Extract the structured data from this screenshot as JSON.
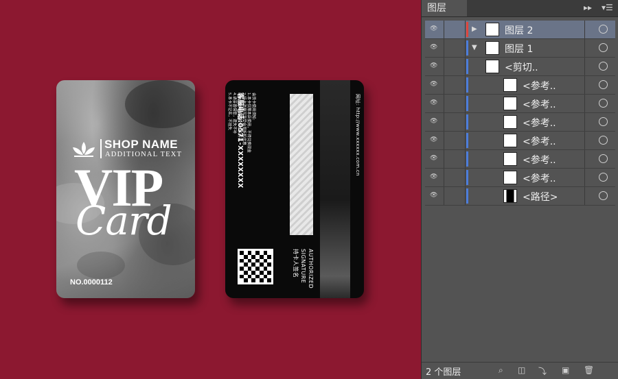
{
  "artwork": {
    "front": {
      "shop_name": "SHOP NAME",
      "additional_text": "ADDITIONAL TEXT",
      "vip": "VIP",
      "card_word": "Card",
      "card_no": "NO.0000112"
    },
    "back": {
      "website": "网址: http://www.xxxxxx.com.cn",
      "hotline": "客服电话:0571-XXXXXXXX",
      "rules": [
        "会员卡使用须知:",
        "1.本卡仅限本店使用，不得兑换现金",
        "2.持卡消费可享受会员折扣优惠",
        "3.本卡最终解释权归本店所有",
        "4.请妥善保管，遗失不补",
        "5.本卡不记名，不挂失"
      ],
      "sign_en_1": "AUTHORIZED",
      "sign_en_2": "SIGNATURE",
      "sign_cn": "持卡人签名"
    }
  },
  "panel": {
    "tab_title": "图层",
    "collapse_icon": "double-chevron-right-icon",
    "menu_icon": "panel-menu-icon",
    "layers": [
      {
        "name": "图层 2",
        "color": "#e0453c",
        "selected": true,
        "indent": 0,
        "expander": "right"
      },
      {
        "name": "图层 1",
        "color": "#4c7ddb",
        "selected": false,
        "indent": 0,
        "expander": "down"
      },
      {
        "name": "<剪切..",
        "color": "#4c7ddb",
        "selected": false,
        "indent": 1,
        "expander": "right"
      },
      {
        "name": "<参考..",
        "color": "#4c7ddb",
        "selected": false,
        "indent": 2,
        "expander": ""
      },
      {
        "name": "<参考..",
        "color": "#4c7ddb",
        "selected": false,
        "indent": 2,
        "expander": ""
      },
      {
        "name": "<参考..",
        "color": "#4c7ddb",
        "selected": false,
        "indent": 2,
        "expander": ""
      },
      {
        "name": "<参考..",
        "color": "#4c7ddb",
        "selected": false,
        "indent": 2,
        "expander": ""
      },
      {
        "name": "<参考..",
        "color": "#4c7ddb",
        "selected": false,
        "indent": 2,
        "expander": ""
      },
      {
        "name": "<参考..",
        "color": "#4c7ddb",
        "selected": false,
        "indent": 2,
        "expander": ""
      },
      {
        "name": "<路径>",
        "color": "#4c7ddb",
        "selected": false,
        "indent": 2,
        "expander": ""
      }
    ],
    "footer": {
      "layer_count": "2 个图层",
      "icons": [
        "locate-object-icon",
        "make-clipping-mask-icon",
        "new-sublayer-icon",
        "new-layer-icon",
        "delete-icon"
      ]
    }
  }
}
